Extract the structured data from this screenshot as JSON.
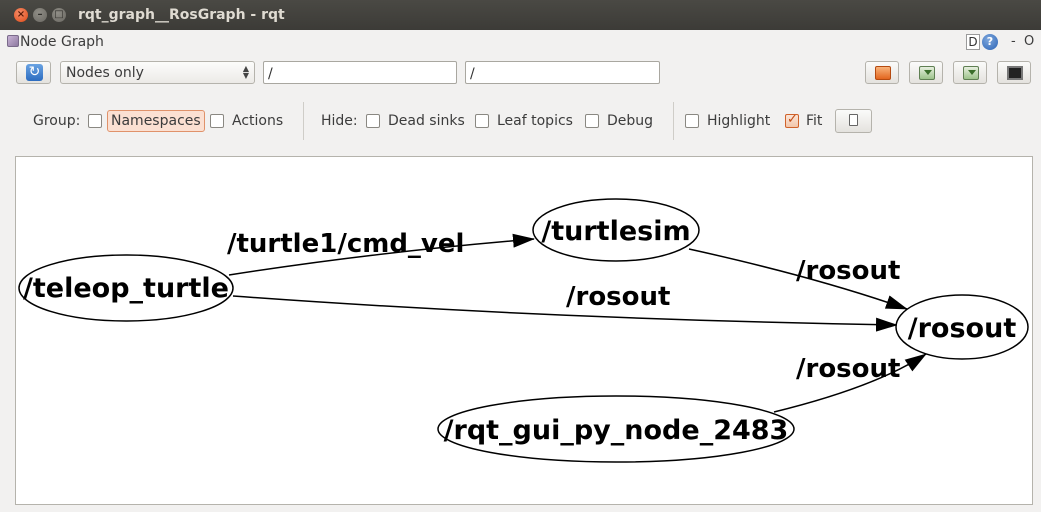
{
  "window": {
    "title": "rqt_graph__RosGraph - rqt",
    "close_glyph": "×",
    "minimize_glyph": "–",
    "maximize_glyph": "□"
  },
  "plugin": {
    "title": "Node Graph",
    "dock_label": "D",
    "help_label": "?",
    "minimize_label": "-",
    "close_label": "O"
  },
  "toolbar": {
    "refresh_icon": "refresh-icon",
    "graph_type_selected": "Nodes only",
    "node_filter_value": "/",
    "topic_filter_value": "/",
    "load_icon": "folder-icon",
    "save_dot_icon": "save-icon",
    "save_svg_icon": "save-icon",
    "screenshot_icon": "screen-icon"
  },
  "options": {
    "group_label": "Group:",
    "namespaces_label": "Namespaces",
    "namespaces_checked": false,
    "actions_label": "Actions",
    "actions_checked": false,
    "hide_label": "Hide:",
    "dead_sinks_label": "Dead sinks",
    "dead_sinks_checked": false,
    "leaf_topics_label": "Leaf topics",
    "leaf_topics_checked": false,
    "debug_label": "Debug",
    "debug_checked": false,
    "highlight_label": "Highlight",
    "highlight_checked": false,
    "fit_label": "Fit",
    "fit_checked": true
  },
  "graph": {
    "nodes": {
      "teleop": "/teleop_turtle",
      "turtlesim": "/turtlesim",
      "rosout": "/rosout",
      "rqt_gui": "/rqt_gui_py_node_2483"
    },
    "edges": {
      "teleop_to_turtlesim": "/turtle1/cmd_vel",
      "teleop_to_rosout": "/rosout",
      "turtlesim_to_rosout": "/rosout",
      "rqt_to_rosout": "/rosout"
    },
    "colors": {
      "line": "#000000",
      "background": "#ffffff"
    }
  }
}
